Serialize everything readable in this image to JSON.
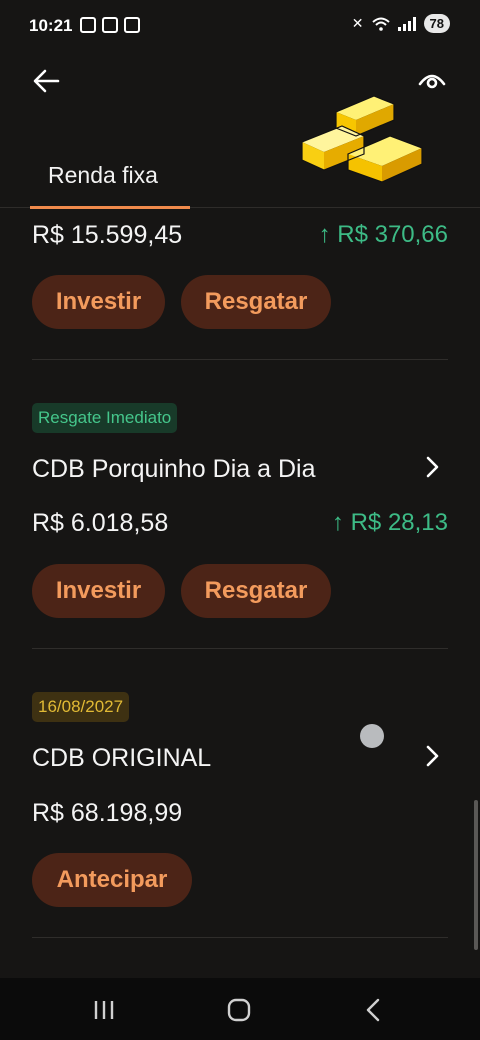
{
  "status": {
    "time": "10:21",
    "battery": "78"
  },
  "icons": {
    "back": "arrow-left-icon",
    "visibility": "eye-icon",
    "illustration": "gold-bars-icon",
    "chevron": "chevron-right-icon",
    "gain_arrow": "arrow-up-icon"
  },
  "tabs": [
    {
      "label": "Renda fixa",
      "active": true
    }
  ],
  "items": [
    {
      "amount": "R$ 15.599,45",
      "gain": "↑ R$ 370,66",
      "invest_label": "Investir",
      "redeem_label": "Resgatar"
    },
    {
      "badge": "Resgate Imediato",
      "title": "CDB Porquinho Dia a Dia",
      "amount": "R$ 6.018,58",
      "gain": "↑ R$ 28,13",
      "invest_label": "Investir",
      "redeem_label": "Resgatar"
    },
    {
      "badge": "16/08/2027",
      "title": "CDB ORIGINAL",
      "amount": "R$ 68.198,99",
      "anticipate_label": "Antecipar"
    }
  ],
  "colors": {
    "background": "#161514",
    "accent": "#f08a4b",
    "pill_bg": "#4c2417",
    "pill_text": "#f39b5d",
    "gain": "#3dbb86",
    "badge_green_text": "#45c68b",
    "badge_yellow_text": "#e1ba35"
  },
  "nav": {
    "recents": "recents-icon",
    "home": "home-icon",
    "back": "nav-back-icon"
  }
}
